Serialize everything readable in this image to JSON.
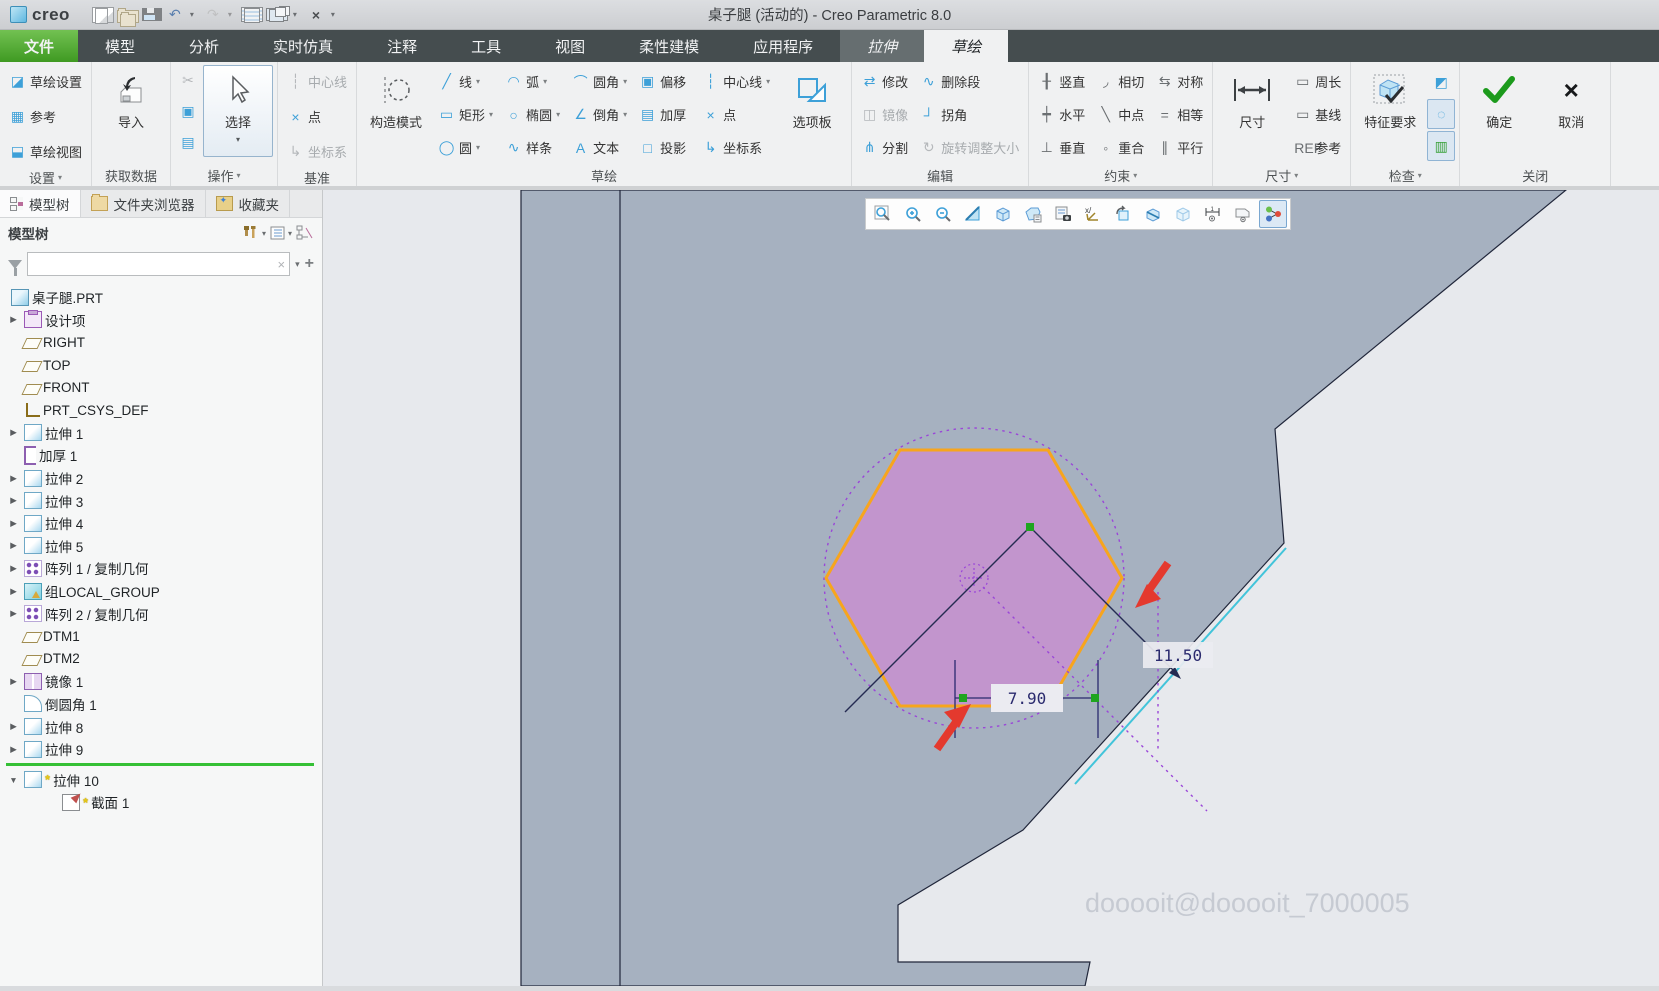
{
  "titlebar": {
    "logo": "creo",
    "title": "桌子腿 (活动的) - Creo Parametric 8.0",
    "qat": [
      {
        "cls": "qi-page",
        "glyph": "",
        "name": "new-file-icon"
      },
      {
        "cls": "qi-folder",
        "glyph": "",
        "name": "open-file-icon"
      },
      {
        "cls": "qi-save",
        "glyph": "",
        "name": "save-icon"
      },
      {
        "glyph": "↶",
        "cls": "",
        "name": "undo-icon"
      },
      {
        "glyph": "▾",
        "cls": "qcaret",
        "name": "undo-caret"
      },
      {
        "glyph": "↷",
        "cls": "dis",
        "name": "redo-icon"
      },
      {
        "glyph": "▾",
        "cls": "qcaret dis",
        "name": "redo-caret"
      },
      {
        "cls": "qi-regen",
        "glyph": "",
        "name": "regenerate-icon"
      },
      {
        "cls": "qi-win",
        "glyph": "",
        "name": "windows-icon"
      },
      {
        "glyph": "▾",
        "cls": "qcaret",
        "name": "windows-caret"
      },
      {
        "glyph": "×",
        "cls": "qclose",
        "name": "close-window-icon"
      },
      {
        "glyph": "▾",
        "cls": "qcaret",
        "name": "qat-customize-caret"
      }
    ]
  },
  "tabs": [
    {
      "label": "文件",
      "cls": "file"
    },
    {
      "label": "模型",
      "cls": ""
    },
    {
      "label": "分析",
      "cls": ""
    },
    {
      "label": "实时仿真",
      "cls": ""
    },
    {
      "label": "注释",
      "cls": ""
    },
    {
      "label": "工具",
      "cls": ""
    },
    {
      "label": "视图",
      "cls": ""
    },
    {
      "label": "柔性建模",
      "cls": ""
    },
    {
      "label": "应用程序",
      "cls": ""
    },
    {
      "label": "拉伸",
      "cls": "context"
    },
    {
      "label": "草绘",
      "cls": "active"
    }
  ],
  "ribbon": {
    "settings": {
      "label": "设置",
      "caret": "▾",
      "items": [
        {
          "label": "草绘设置",
          "glyph": "◪",
          "caret": "",
          "cls": ""
        },
        {
          "label": "参考",
          "glyph": "▦",
          "caret": "",
          "cls": ""
        },
        {
          "label": "草绘视图",
          "glyph": "⬓",
          "caret": "",
          "cls": ""
        }
      ]
    },
    "getdata": {
      "label": "获取数据",
      "big": "导入"
    },
    "operations": {
      "label": "操作",
      "caret": "▾",
      "select": "选择",
      "clipboard": [
        {
          "glyph": "✂",
          "cls": "dis",
          "name": "cut-icon"
        },
        {
          "glyph": "▣",
          "cls": "",
          "name": "copy-icon"
        },
        {
          "glyph": "▤",
          "cls": "",
          "name": "paste-icon"
        }
      ]
    },
    "datum": {
      "label": "基准",
      "items": [
        {
          "label": "中心线",
          "glyph": "┆",
          "caret": "",
          "cls": "dis"
        },
        {
          "label": "点",
          "glyph": "×",
          "caret": "",
          "cls": ""
        },
        {
          "label": "坐标系",
          "glyph": "↳",
          "caret": "",
          "cls": "dis"
        }
      ]
    },
    "sketch": {
      "label": "草绘",
      "construction": "构造模式",
      "palette": "选项板",
      "col1": [
        {
          "label": "线",
          "glyph": "╱",
          "caret": "▾",
          "cls": ""
        },
        {
          "label": "矩形",
          "glyph": "▭",
          "caret": "▾",
          "cls": ""
        },
        {
          "label": "圆",
          "glyph": "◯",
          "caret": "▾",
          "cls": ""
        }
      ],
      "col2": [
        {
          "label": "弧",
          "glyph": "◠",
          "caret": "▾",
          "cls": ""
        },
        {
          "label": "椭圆",
          "glyph": "○",
          "caret": "▾",
          "cls": ""
        },
        {
          "label": "样条",
          "glyph": "∿",
          "caret": "",
          "cls": ""
        }
      ],
      "col3": [
        {
          "label": "圆角",
          "glyph": "⌒",
          "caret": "▾",
          "cls": ""
        },
        {
          "label": "倒角",
          "glyph": "∠",
          "caret": "▾",
          "cls": ""
        },
        {
          "label": "文本",
          "glyph": "A",
          "caret": "",
          "cls": ""
        }
      ],
      "col4": [
        {
          "label": "偏移",
          "glyph": "▣",
          "caret": "",
          "cls": ""
        },
        {
          "label": "加厚",
          "glyph": "▤",
          "caret": "",
          "cls": ""
        },
        {
          "label": "投影",
          "glyph": "□",
          "caret": "",
          "cls": ""
        }
      ],
      "col5": [
        {
          "label": "中心线",
          "glyph": "┆",
          "caret": "▾",
          "cls": ""
        },
        {
          "label": "点",
          "glyph": "×",
          "caret": "",
          "cls": ""
        },
        {
          "label": "坐标系",
          "glyph": "↳",
          "caret": "",
          "cls": ""
        }
      ]
    },
    "edit": {
      "label": "编辑",
      "col1": [
        {
          "label": "修改",
          "glyph": "⇄",
          "caret": "",
          "cls": ""
        },
        {
          "label": "镜像",
          "glyph": "◫",
          "caret": "",
          "cls": "dis"
        },
        {
          "label": "分割",
          "glyph": "⋔",
          "caret": "",
          "cls": ""
        }
      ],
      "col2": [
        {
          "label": "删除段",
          "glyph": "∿",
          "caret": "",
          "cls": "g-red-item"
        },
        {
          "label": "拐角",
          "glyph": "┘",
          "caret": "",
          "cls": ""
        },
        {
          "label": "旋转调整大小",
          "glyph": "↻",
          "caret": "",
          "cls": "dis"
        }
      ]
    },
    "constraints": {
      "label": "约束",
      "caret": "▾",
      "col1": [
        {
          "label": "竖直",
          "glyph": "╂",
          "caret": "",
          "cls": ""
        },
        {
          "label": "水平",
          "glyph": "┿",
          "caret": "",
          "cls": ""
        },
        {
          "label": "垂直",
          "glyph": "⊥",
          "caret": "",
          "cls": ""
        }
      ],
      "col2": [
        {
          "label": "相切",
          "glyph": "◞",
          "caret": "",
          "cls": ""
        },
        {
          "label": "中点",
          "glyph": "╲",
          "caret": "",
          "cls": ""
        },
        {
          "label": "重合",
          "glyph": "◦",
          "caret": "",
          "cls": ""
        }
      ],
      "col3": [
        {
          "label": "对称",
          "glyph": "⇆",
          "caret": "",
          "cls": ""
        },
        {
          "label": "相等",
          "glyph": "=",
          "caret": "",
          "cls": ""
        },
        {
          "label": "平行",
          "glyph": "∥",
          "caret": "",
          "cls": ""
        }
      ]
    },
    "dimension": {
      "label": "尺寸",
      "caret": "▾",
      "big": "尺寸",
      "items": [
        {
          "label": "周长",
          "glyph": "▭",
          "caret": "",
          "cls": ""
        },
        {
          "label": "基线",
          "glyph": "▭",
          "caret": "",
          "cls": ""
        },
        {
          "label": "参考",
          "glyph": "REF",
          "caret": "",
          "cls": "g-ref-item"
        }
      ]
    },
    "inspect": {
      "label": "检查",
      "caret": "▾",
      "big": "特征要求",
      "toggles": [
        {
          "glyph": "◩",
          "cls": "",
          "name": "highlight-open-ends-icon"
        },
        {
          "glyph": "◌",
          "cls": "pressed",
          "name": "overlapping-geometry-icon"
        },
        {
          "glyph": "▥",
          "cls": "pressed green",
          "name": "feature-requirements-toggle-icon"
        }
      ]
    },
    "close": {
      "label": "关闭",
      "ok": "确定",
      "cancel": "取消"
    }
  },
  "navigator": {
    "tabs": [
      {
        "label": "模型树",
        "cls": "active",
        "icon": "ni-tree"
      },
      {
        "label": "文件夹浏览器",
        "cls": "",
        "icon": "ni-folder"
      },
      {
        "label": "收藏夹",
        "cls": "",
        "icon": "ni-fav"
      }
    ],
    "header": {
      "title": "模型树"
    },
    "filter": {
      "value": "",
      "placeholder": "",
      "clear": "×"
    },
    "tree": [
      {
        "label": "桌子腿.PRT",
        "icon": "i-part",
        "arrow": "",
        "star": "",
        "cls": "root"
      },
      {
        "label": "设计项",
        "icon": "i-design",
        "arrow": "▶",
        "star": "",
        "cls": ""
      },
      {
        "label": "RIGHT",
        "icon": "i-plane",
        "arrow": "",
        "star": "",
        "cls": ""
      },
      {
        "label": "TOP",
        "icon": "i-plane",
        "arrow": "",
        "star": "",
        "cls": ""
      },
      {
        "label": "FRONT",
        "icon": "i-plane",
        "arrow": "",
        "star": "",
        "cls": ""
      },
      {
        "label": "PRT_CSYS_DEF",
        "icon": "i-csys",
        "arrow": "",
        "star": "",
        "cls": ""
      },
      {
        "label": "拉伸 1",
        "icon": "i-extrude",
        "arrow": "▶",
        "star": "",
        "cls": ""
      },
      {
        "label": "加厚 1",
        "icon": "i-thicken",
        "arrow": "",
        "star": "",
        "cls": ""
      },
      {
        "label": "拉伸 2",
        "icon": "i-extrude",
        "arrow": "▶",
        "star": "",
        "cls": ""
      },
      {
        "label": "拉伸 3",
        "icon": "i-extrude",
        "arrow": "▶",
        "star": "",
        "cls": ""
      },
      {
        "label": "拉伸 4",
        "icon": "i-extrude",
        "arrow": "▶",
        "star": "",
        "cls": ""
      },
      {
        "label": "拉伸 5",
        "icon": "i-extrude",
        "arrow": "▶",
        "star": "",
        "cls": ""
      },
      {
        "label": "阵列 1 / 复制几何",
        "icon": "i-pattern",
        "arrow": "▶",
        "star": "",
        "cls": ""
      },
      {
        "label": "组LOCAL_GROUP",
        "icon": "i-group",
        "arrow": "▶",
        "star": "",
        "cls": ""
      },
      {
        "label": "阵列 2 / 复制几何",
        "icon": "i-pattern",
        "arrow": "▶",
        "star": "",
        "cls": ""
      },
      {
        "label": "DTM1",
        "icon": "i-plane",
        "arrow": "",
        "star": "",
        "cls": ""
      },
      {
        "label": "DTM2",
        "icon": "i-plane",
        "arrow": "",
        "star": "",
        "cls": ""
      },
      {
        "label": "镜像 1",
        "icon": "i-mirror",
        "arrow": "▶",
        "star": "",
        "cls": ""
      },
      {
        "label": "倒圆角 1",
        "icon": "i-round",
        "arrow": "",
        "star": "",
        "cls": ""
      },
      {
        "label": "拉伸 8",
        "icon": "i-extrude",
        "arrow": "▶",
        "star": "",
        "cls": ""
      },
      {
        "label": "拉伸 9",
        "icon": "i-extrude",
        "arrow": "▶",
        "star": "",
        "cls": ""
      },
      {
        "label": "",
        "icon": "",
        "arrow": "",
        "star": "",
        "cls": "sep"
      },
      {
        "label": "拉伸 10",
        "icon": "i-extrude",
        "arrow": "▼",
        "star": "*",
        "cls": ""
      },
      {
        "label": "截面 1",
        "icon": "i-sketch",
        "arrow": "",
        "star": "*",
        "cls": "ind1"
      }
    ]
  },
  "graphics_toolbar": [
    "zoom-window",
    "zoom-in",
    "zoom-out",
    "repaint",
    "display-style",
    "saved-orientations",
    "view-manager",
    "datum-display-filters",
    "sketch-view-orientation",
    "section-view",
    "shade-view",
    "dimension-display",
    "annotation-display",
    "sketcher-display-filters"
  ],
  "sketch_view": {
    "dim_width": "7.90",
    "dim_diag": "11.50",
    "watermark": "dooooit@dooooit_7000005",
    "colors": {
      "surface": "#a6b1c0",
      "hexagon_fill": "#c791cf",
      "hexagon_border": "#f7a51d",
      "construction": "#9a46d8",
      "dimension": "#2a2a6e",
      "arrow": "#e4392e",
      "edge_highlight": "#42c4da"
    }
  }
}
